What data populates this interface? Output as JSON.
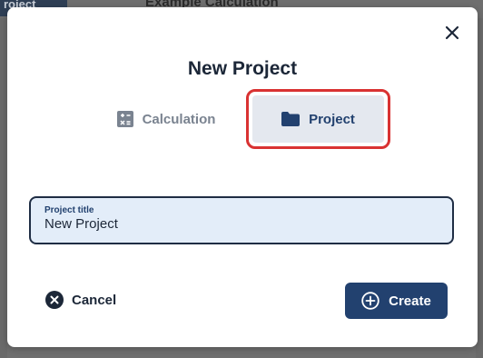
{
  "background": {
    "tab_label": "roject",
    "heading": "Example Calculation"
  },
  "modal": {
    "title": "New Project",
    "types": [
      {
        "label": "Calculation",
        "icon": "calculator-icon",
        "selected": false
      },
      {
        "label": "Project",
        "icon": "folder-icon",
        "selected": true
      }
    ],
    "project_title_field": {
      "label": "Project title",
      "value": "New Project"
    },
    "cancel_label": "Cancel",
    "create_label": "Create"
  },
  "colors": {
    "primary": "#22416f",
    "highlight_border": "#d93232",
    "field_bg": "#e3edf9",
    "selected_bg": "#e4e8ef"
  }
}
